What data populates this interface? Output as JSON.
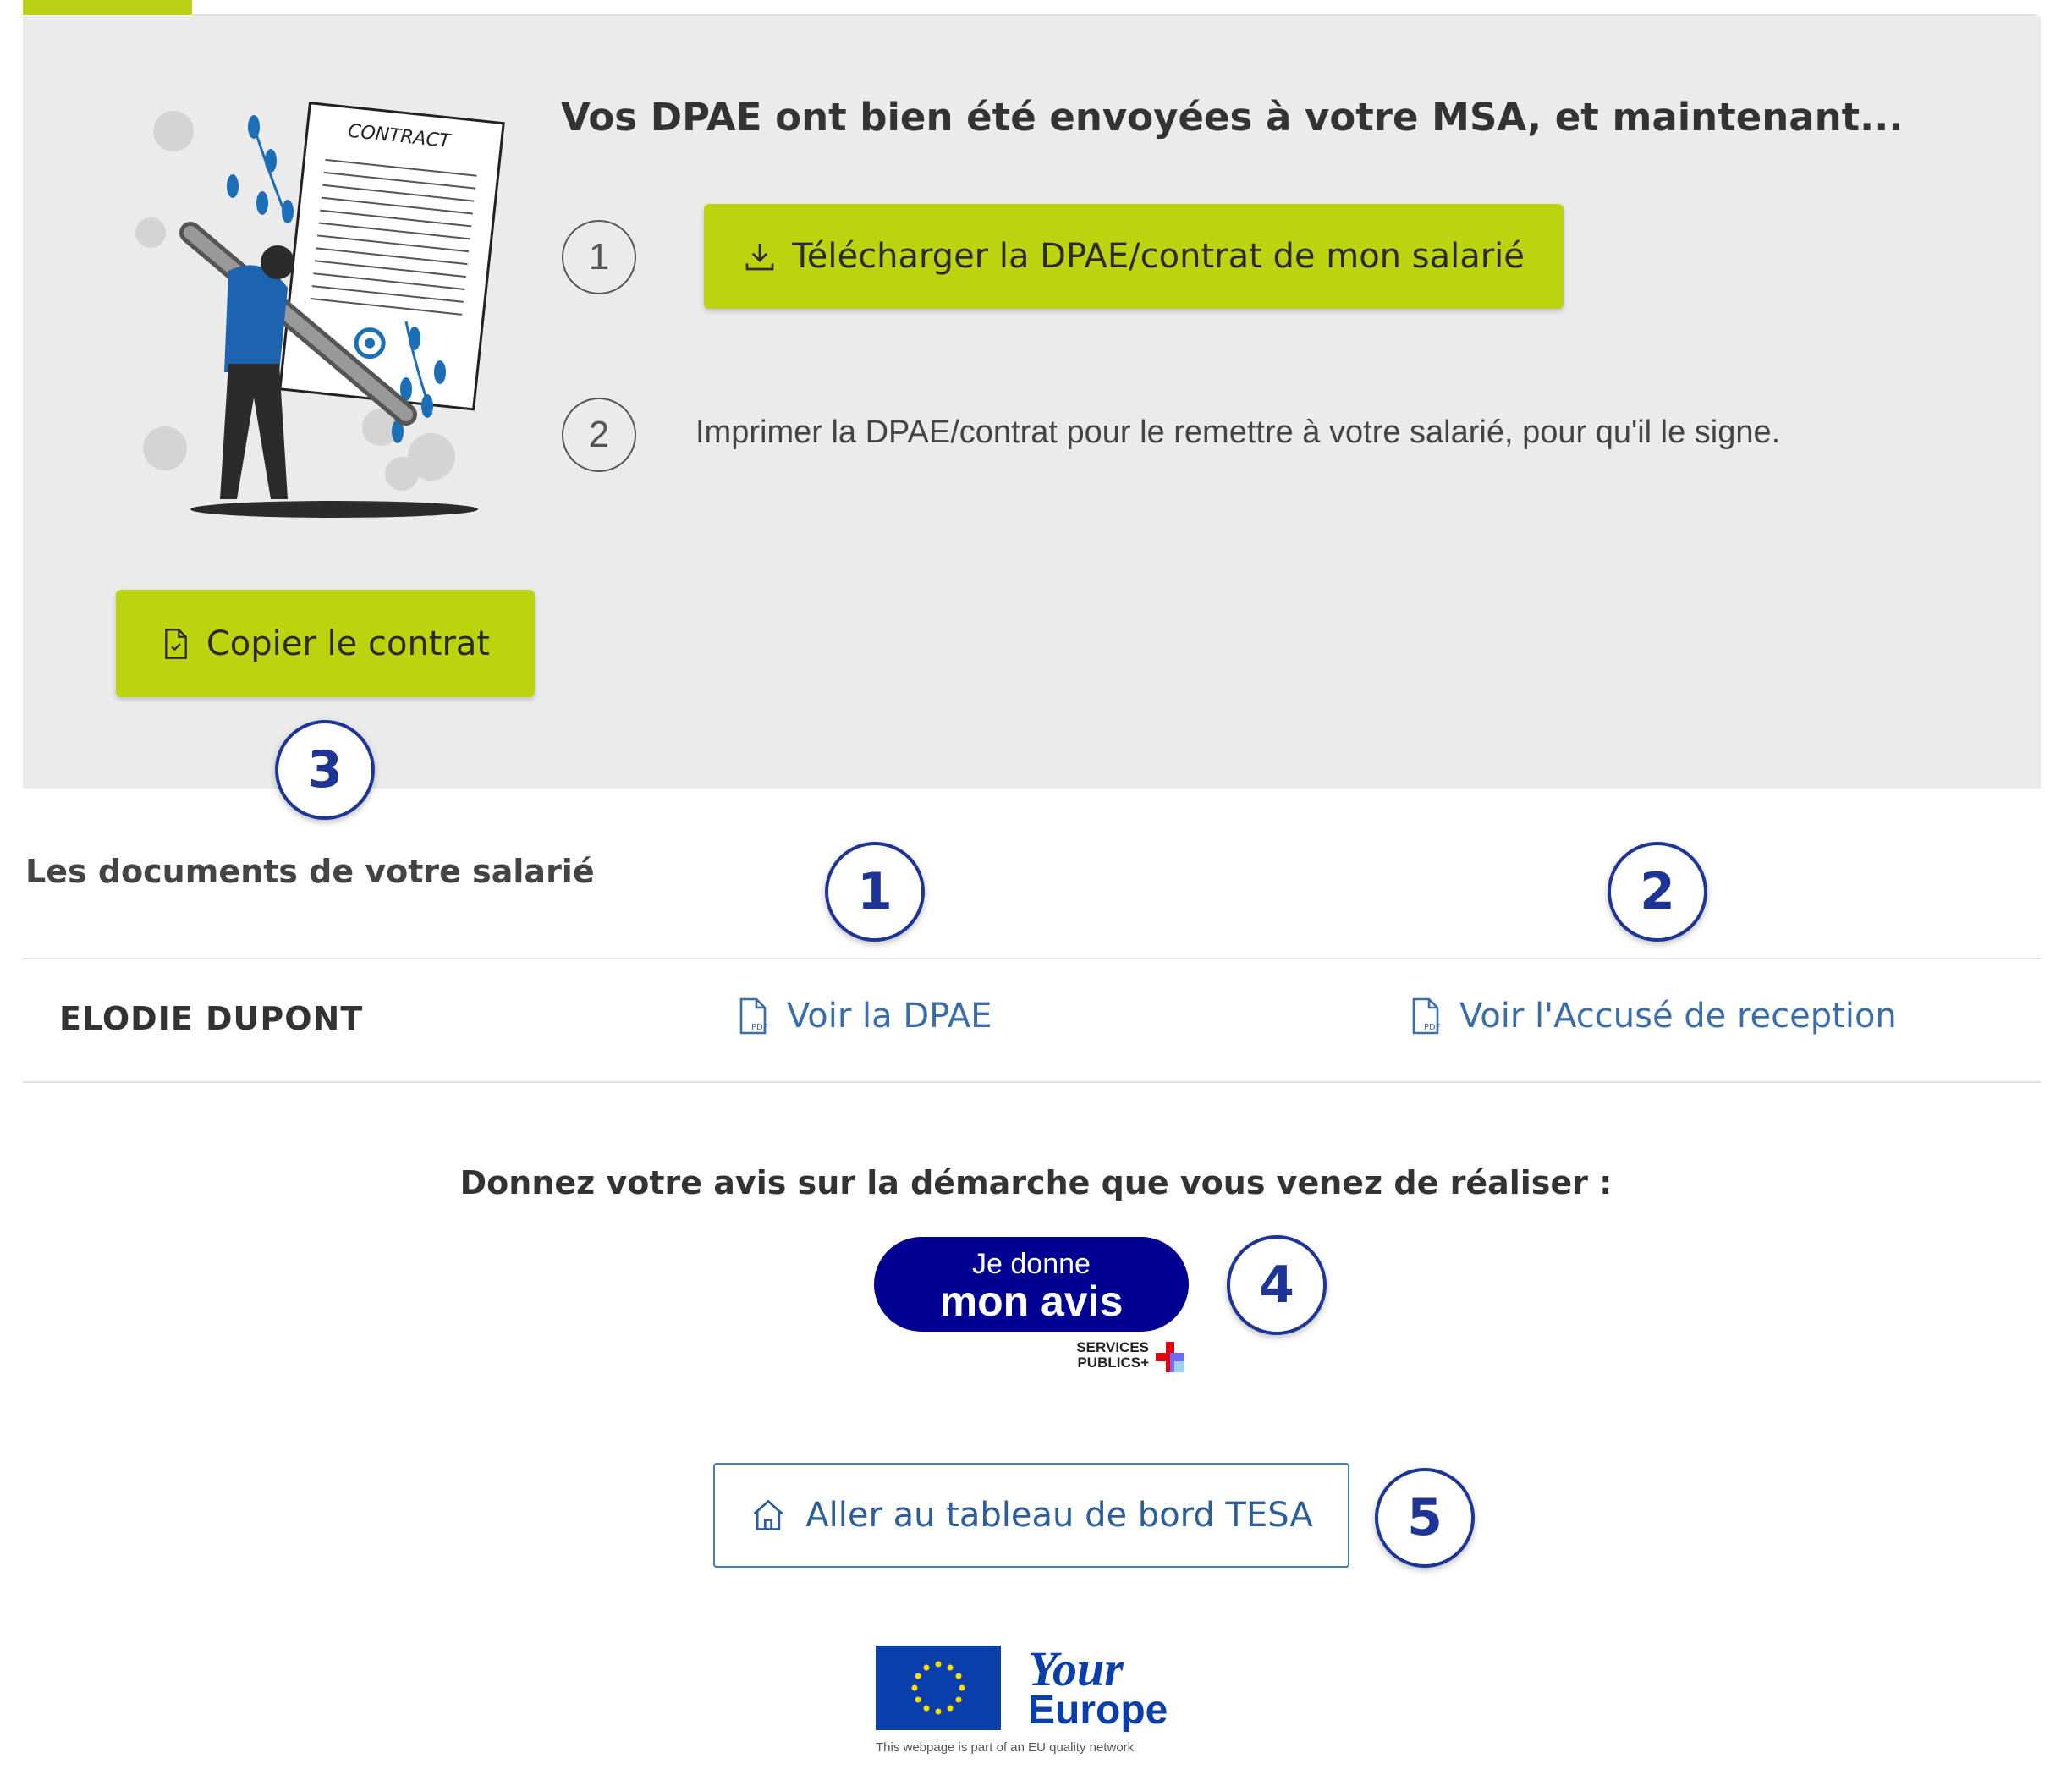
{
  "panel": {
    "heading": "Vos DPAE ont bien été envoyées à votre MSA, et maintenant...",
    "steps": [
      {
        "number": "1",
        "button_label": "Télécharger la DPAE/contrat de mon salarié"
      },
      {
        "number": "2",
        "text": "Imprimer la DPAE/contrat pour le remettre à votre salarié, pour qu'il le signe."
      }
    ],
    "illustration_label": "CONTRACT",
    "copy_button_label": "Copier le contrat"
  },
  "documents": {
    "title": "Les documents de votre salarié",
    "rows": [
      {
        "employee": "ELODIE DUPONT",
        "link_dpae": "Voir la DPAE",
        "link_ar": "Voir l'Accusé de reception"
      }
    ]
  },
  "feedback": {
    "question": "Donnez votre avis sur la démarche que vous venez de réaliser :",
    "button_line1": "Je donne",
    "button_line2": "mon avis",
    "services_publics": "SERVICES PUBLICS+"
  },
  "dashboard_button_label": "Aller au tableau de bord TESA",
  "your_europe": {
    "line1": "Your",
    "line2": "Europe",
    "caption": "This webpage is part of an EU quality network"
  },
  "callouts": [
    "3",
    "1",
    "2",
    "4",
    "5"
  ],
  "colors": {
    "accent_green": "#bcd40f",
    "callout_blue": "#1f3596",
    "link_blue": "#3b6ea8",
    "avis_blue": "#000091"
  }
}
